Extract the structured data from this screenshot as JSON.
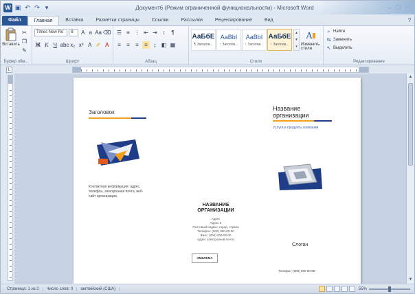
{
  "window": {
    "title": "Документ6 (Режим ограниченной функциональности) - Microsoft Word",
    "logo_letter": "W",
    "controls": [
      "–",
      "❐",
      "✕"
    ]
  },
  "quick_access": {
    "save_icon": "save-icon",
    "undo_icon": "undo-icon",
    "redo_icon": "redo-icon",
    "customize_icon": "chevron-down-icon"
  },
  "tabs": [
    {
      "label": "Файл",
      "kind": "file"
    },
    {
      "label": "Главная",
      "kind": "active"
    },
    {
      "label": "Вставка",
      "kind": "normal"
    },
    {
      "label": "Разметка страницы",
      "kind": "normal"
    },
    {
      "label": "Ссылки",
      "kind": "normal"
    },
    {
      "label": "Рассылки",
      "kind": "normal"
    },
    {
      "label": "Рецензирование",
      "kind": "normal"
    },
    {
      "label": "Вид",
      "kind": "normal"
    }
  ],
  "ribbon": {
    "clipboard": {
      "paste_label": "Вставить",
      "group_label": "Буфер обм..."
    },
    "font": {
      "font_name": "Times New Ro",
      "font_size": "8",
      "group_label": "Шрифт"
    },
    "paragraph": {
      "group_label": "Абзац"
    },
    "styles": {
      "items": [
        {
          "sample": "АаБбЕ",
          "name": "¶ Заголов...",
          "selected": false,
          "heading": true
        },
        {
          "sample": "AaBbI",
          "name": "↑ Заголов...",
          "selected": false,
          "heading": false
        },
        {
          "sample": "AaBbI",
          "name": "↑ Заголов...",
          "selected": false,
          "heading": false
        },
        {
          "sample": "АаБбЕ",
          "name": "↑ Заголов...",
          "selected": true,
          "heading": true
        }
      ],
      "change_label": "Изменить стили",
      "group_label": "Стили"
    },
    "editing": {
      "items": [
        "Найти",
        "Заменить",
        "Выделить"
      ],
      "group_label": "Редактирование"
    }
  },
  "document": {
    "left_heading": "Заголовок",
    "left_body": "Контактная информация: адрес, телефон, электронная почта, веб-сайт организации.",
    "org_title_line1": "Название",
    "org_title_line2": "организации",
    "org_subtitle": "Услуги и продукты компании",
    "center_title_line1": "НАЗВАНИЕ",
    "center_title_line2": "ОРГАНИЗАЦИИ",
    "center_lines": [
      "Адрес",
      "Адрес 2",
      "Почтовый индекс, город, страна",
      "Телефон: (000) 000-00-00",
      "Факс: (000) 000-00-00",
      "Адрес электронной почты"
    ],
    "logo_label": "ЭМБЛЕМА",
    "slogan": "Слоган",
    "phone": "Телефон: (000) 000-00-00"
  },
  "status": {
    "page": "Страница: 1 из 2",
    "words": "Число слов: 0",
    "language": "английский (США)",
    "zoom": "55%"
  },
  "colors": {
    "brand_blue": "#2b5797",
    "accent_orange": "#f2a01b",
    "navy": "#1f3c88"
  }
}
